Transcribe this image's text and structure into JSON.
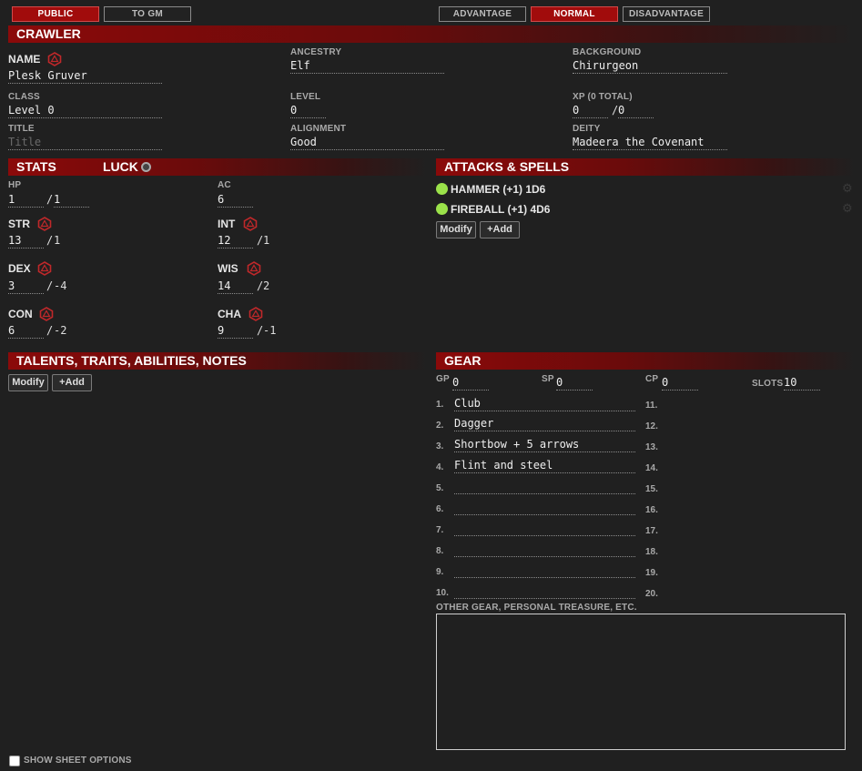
{
  "roll_target": {
    "public": "PUBLIC",
    "to_gm": "TO GM"
  },
  "roll_mode": {
    "advantage": "ADVANTAGE",
    "normal": "NORMAL",
    "disadvantage": "DISADVANTAGE"
  },
  "crawler": {
    "header": "CRAWLER",
    "name_label": "NAME",
    "name": "Plesk Gruver",
    "ancestry_label": "ANCESTRY",
    "ancestry": "Elf",
    "background_label": "BACKGROUND",
    "background": "Chirurgeon",
    "class_label": "CLASS",
    "class": "Level 0",
    "level_label": "LEVEL",
    "level": "0",
    "xp_label": "XP (0 TOTAL)",
    "xp": "0",
    "xp_max": "0",
    "title_label": "TITLE",
    "title_placeholder": "Title",
    "alignment_label": "ALIGNMENT",
    "alignment": "Good",
    "deity_label": "DEITY",
    "deity": "Madeera the Covenant"
  },
  "stats": {
    "header": "STATS",
    "luck_label": "LUCK",
    "hp_label": "HP",
    "hp": "1",
    "hp_max": "1",
    "ac_label": "AC",
    "ac": "6",
    "str": {
      "label": "STR",
      "score": "13",
      "mod": "1"
    },
    "int": {
      "label": "INT",
      "score": "12",
      "mod": "1"
    },
    "dex": {
      "label": "DEX",
      "score": "3",
      "mod": "-4"
    },
    "wis": {
      "label": "WIS",
      "score": "14",
      "mod": "2"
    },
    "con": {
      "label": "CON",
      "score": "6",
      "mod": "-2"
    },
    "cha": {
      "label": "CHA",
      "score": "9",
      "mod": "-1"
    }
  },
  "attacks": {
    "header": "ATTACKS & SPELLS",
    "items": [
      "HAMMER (+1) 1D6",
      "FIREBALL (+1) 4D6"
    ],
    "status_color": "#9be24a",
    "modify_label": "Modify",
    "add_label": "+Add"
  },
  "talents": {
    "header": "TALENTS, TRAITS, ABILITIES, NOTES",
    "modify_label": "Modify",
    "add_label": "+Add"
  },
  "gear": {
    "header": "GEAR",
    "gp_label": "GP",
    "gp": "0",
    "sp_label": "SP",
    "sp": "0",
    "cp_label": "CP",
    "cp": "0",
    "slots_label": "SLOTS",
    "slots": "10",
    "numbers_left": [
      "1.",
      "2.",
      "3.",
      "4.",
      "5.",
      "6.",
      "7.",
      "8.",
      "9.",
      "10."
    ],
    "numbers_right": [
      "11.",
      "12.",
      "13.",
      "14.",
      "15.",
      "16.",
      "17.",
      "18.",
      "19.",
      "20."
    ],
    "items": [
      "Club",
      "Dagger",
      "Shortbow + 5 arrows",
      "Flint and steel",
      "",
      "",
      "",
      "",
      "",
      ""
    ],
    "other_label": "OTHER GEAR, PERSONAL TREASURE, ETC."
  },
  "options": {
    "show_sheet_options": "SHOW SHEET OPTIONS"
  },
  "colors": {
    "accent": "#a10c0c",
    "background": "#202020",
    "die": "#c0282a"
  }
}
